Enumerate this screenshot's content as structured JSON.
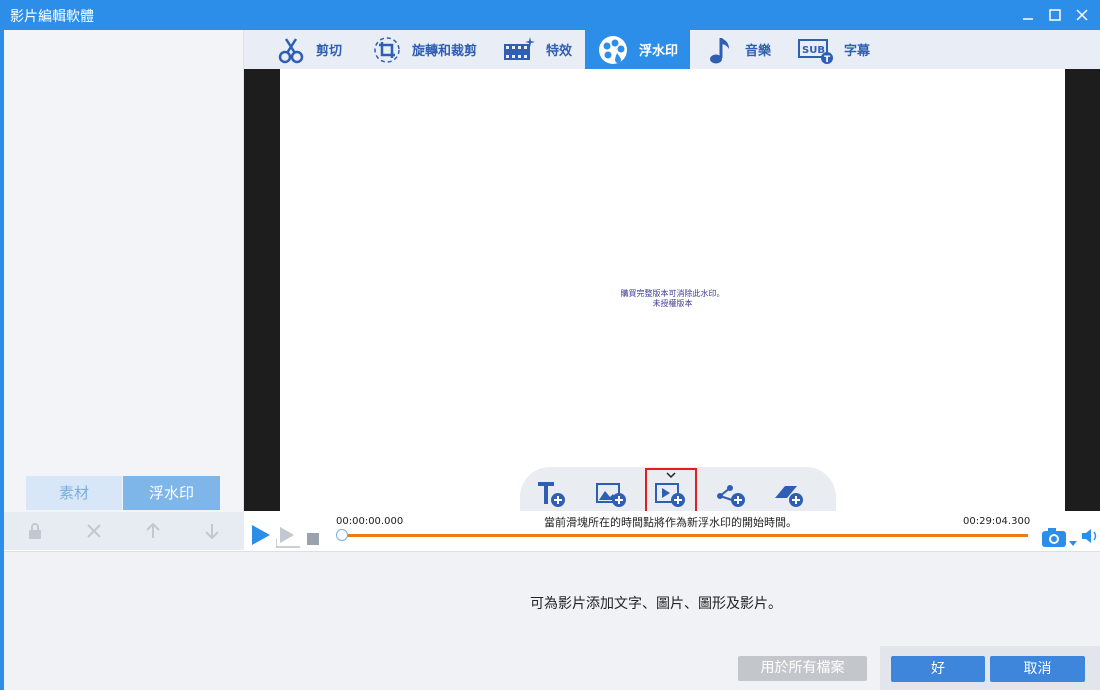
{
  "window": {
    "title": "影片編輯軟體"
  },
  "top_tabs": [
    {
      "label": "剪切",
      "icon": "scissors-icon",
      "active": false
    },
    {
      "label": "旋轉和裁剪",
      "icon": "rotate-crop-icon",
      "active": false
    },
    {
      "label": "特效",
      "icon": "effects-icon",
      "active": false
    },
    {
      "label": "浮水印",
      "icon": "watermark-icon",
      "active": true
    },
    {
      "label": "音樂",
      "icon": "music-icon",
      "active": false
    },
    {
      "label": "字幕",
      "icon": "subtitle-icon",
      "active": false
    }
  ],
  "preview": {
    "watermark_line1": "購買完整版本可消除此水印。",
    "watermark_line2": "未授權版本"
  },
  "watermark_tools": [
    {
      "name": "add-text-icon",
      "highlighted": false
    },
    {
      "name": "add-image-icon",
      "highlighted": false
    },
    {
      "name": "add-video-icon",
      "highlighted": true
    },
    {
      "name": "add-shape-icon",
      "highlighted": false
    },
    {
      "name": "add-eraser-icon",
      "highlighted": false
    }
  ],
  "playback": {
    "current_time": "00:00:00.000",
    "total_time": "00:29:04.300",
    "hint": "當前滑塊所在的時間點將作為新浮水印的開始時間。",
    "progress": 0
  },
  "left_panel": {
    "tab_material": "素材",
    "tab_watermark": "浮水印",
    "active_tab": "浮水印"
  },
  "bottom": {
    "info": "可為影片添加文字、圖片、圖形及影片。",
    "apply_all": "用於所有檔案",
    "ok": "好",
    "cancel": "取消"
  },
  "colors": {
    "accent": "#2c8ee8",
    "progress": "#f07a12",
    "highlight_box": "#e0201e"
  }
}
